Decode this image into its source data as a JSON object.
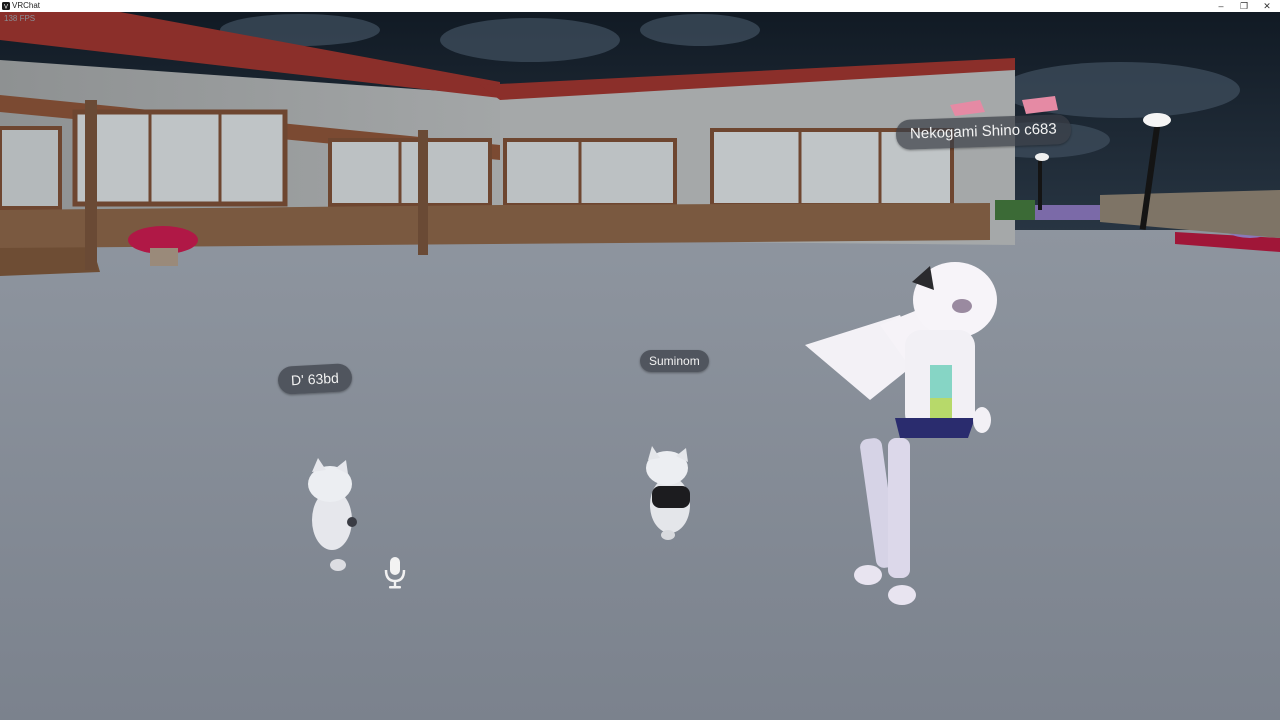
{
  "window": {
    "title": "VRChat",
    "controls": {
      "minimize": "–",
      "maximize": "❐",
      "close": "✕"
    }
  },
  "hud": {
    "fps": "138 FPS"
  },
  "players": [
    {
      "name": "Nekogami Shino c683"
    },
    {
      "name": "D' 63bd"
    },
    {
      "name": "Suminom"
    }
  ],
  "icons": {
    "app": "vrchat-app-icon",
    "mic": "microphone-icon"
  },
  "colors": {
    "sky": "#1f2a36",
    "ground": "#848b96",
    "building_wall": "#9a9d9e",
    "roof": "#8b2f2a",
    "nameplate": "#3a3e46"
  }
}
